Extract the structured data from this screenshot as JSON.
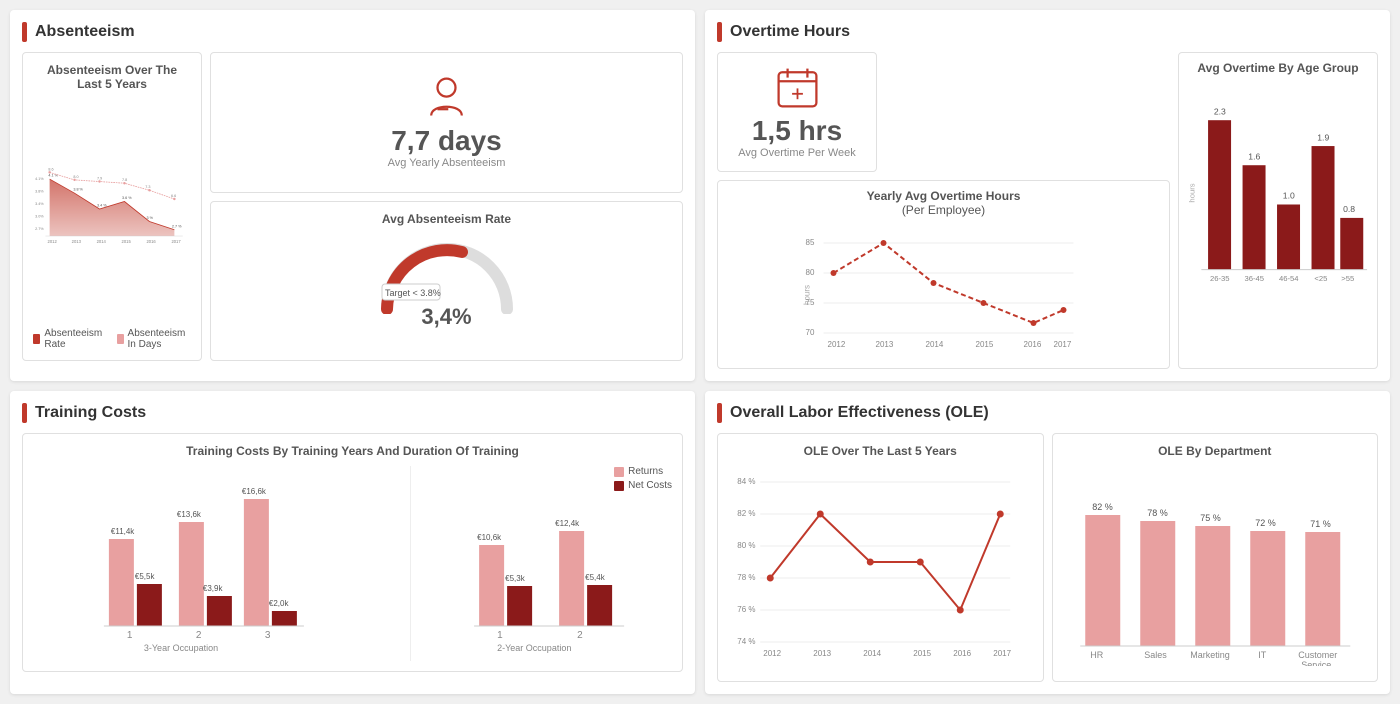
{
  "absenteeism": {
    "title": "Absenteeism",
    "metric_value": "7,7 days",
    "metric_sub": "Avg Yearly Absenteeism",
    "gauge_title": "Avg Absenteeism Rate",
    "gauge_target": "Target < 3.8%",
    "gauge_value": "3,4%",
    "chart_title": "Absenteeism Over The Last 5 Years",
    "years": [
      "2012",
      "2013",
      "2014",
      "2015",
      "2016",
      "2017"
    ],
    "days": [
      8.6,
      8.0,
      7.9,
      7.8,
      7.3,
      6.6
    ],
    "rates": [
      4.1,
      3.8,
      3.4,
      3.6,
      3.0,
      2.7
    ],
    "legend_rate": "Absenteeism Rate",
    "legend_days": "Absenteeism In Days"
  },
  "overtime": {
    "title": "Overtime Hours",
    "metric_value": "1,5 hrs",
    "metric_sub": "Avg Overtime Per Week",
    "line_chart_title": "Yearly Avg Overtime Hours\n(Per Employee)",
    "bar_chart_title": "Avg Overtime By Age Group",
    "years": [
      "2012",
      "2013",
      "2014",
      "2015",
      "2016",
      "2017"
    ],
    "line_values": [
      80,
      85,
      78,
      75,
      72,
      74
    ],
    "age_groups": [
      "26-35",
      "36-45",
      "46-54",
      "<25",
      ">55"
    ],
    "age_values": [
      2.3,
      1.6,
      1.0,
      1.9,
      0.8
    ],
    "y_axis_label": "hours"
  },
  "training": {
    "title": "Training Costs",
    "chart_title": "Training Costs By Training Years And Duration Of Training",
    "legend_returns": "Returns",
    "legend_net": "Net Costs",
    "three_year": {
      "label": "3-Year Occupation",
      "categories": [
        "1",
        "2",
        "3"
      ],
      "returns": [
        11400,
        13600,
        16600
      ],
      "net_costs": [
        5500,
        3900,
        2000
      ],
      "returns_labels": [
        "€11,4k",
        "€13,6k",
        "€16,6k"
      ],
      "net_labels": [
        "€5,5k",
        "€3,9k",
        "€2,0k"
      ]
    },
    "two_year": {
      "label": "2-Year Occupation",
      "categories": [
        "1",
        "2"
      ],
      "returns": [
        10600,
        12400
      ],
      "net_costs": [
        5300,
        5400
      ],
      "returns_labels": [
        "€10,6k",
        "€12,4k"
      ],
      "net_labels": [
        "€5,3k",
        "€5,4k"
      ]
    }
  },
  "ole": {
    "title": "Overall Labor Effectiveness (OLE)",
    "line_chart_title": "OLE Over The Last 5 Years",
    "bar_chart_title": "OLE By Department",
    "years": [
      "2012",
      "2013",
      "2014",
      "2015",
      "2016",
      "2017"
    ],
    "line_values": [
      78,
      82,
      79,
      79,
      76,
      82
    ],
    "departments": [
      "HR",
      "Sales",
      "Marketing",
      "IT",
      "Customer\nService"
    ],
    "dept_values": [
      82,
      78,
      75,
      72,
      71
    ],
    "dept_labels": [
      "82 %",
      "78 %",
      "75 %",
      "72 %",
      "71 %"
    ],
    "y_min": 74,
    "y_max": 84
  }
}
